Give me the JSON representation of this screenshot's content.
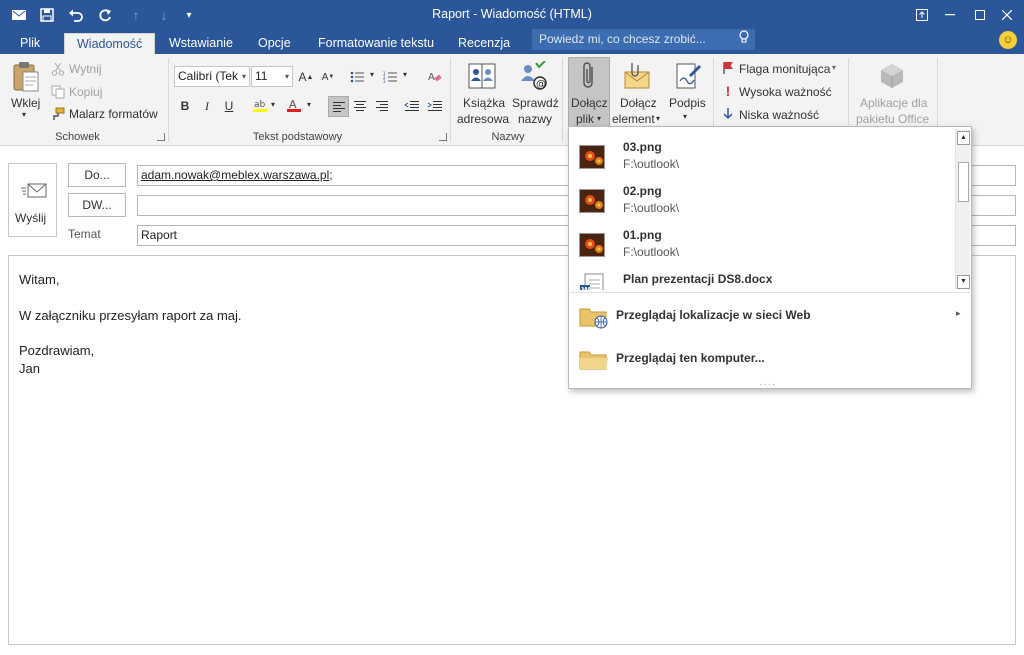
{
  "window": {
    "title": "Raport - Wiadomość (HTML)"
  },
  "tabs": [
    "Plik",
    "Wiadomość",
    "Wstawianie",
    "Opcje",
    "Formatowanie tekstu",
    "Recenzja"
  ],
  "tell_me": {
    "placeholder": "Powiedz mi, co chcesz zrobić..."
  },
  "ribbon": {
    "schowek": {
      "label": "Schowek",
      "paste": "Wklej",
      "cut": "Wytnij",
      "copy": "Kopiuj",
      "format_painter": "Malarz formatów"
    },
    "text": {
      "label": "Tekst podstawowy",
      "font": "Calibri (Tek",
      "size": "11",
      "bold": "B",
      "italic": "I",
      "underline": "U"
    },
    "names": {
      "label": "Nazwy",
      "address_book_1": "Książka",
      "address_book_2": "adresowa",
      "check_names_1": "Sprawdź",
      "check_names_2": "nazwy"
    },
    "include": {
      "attach_file_1": "Dołącz",
      "attach_file_2": "plik",
      "attach_item_1": "Dołącz",
      "attach_item_2": "element",
      "signature": "Podpis"
    },
    "tags": {
      "follow_up": "Flaga monitująca",
      "high_importance": "Wysoka ważność",
      "low_importance": "Niska ważność"
    },
    "addins": {
      "apps_1": "Aplikacje dla",
      "apps_2": "pakietu Office"
    }
  },
  "compose": {
    "send": "Wyślij",
    "to_button": "Do...",
    "cc_button": "DW...",
    "subject_label": "Temat",
    "to_value": "adam.nowak@meblex.warszawa.pl;",
    "cc_value": "",
    "subject_value": "Raport"
  },
  "body": {
    "line1": "Witam,",
    "line2": "W załączniku przesyłam raport za maj.",
    "line3": "Pozdrawiam,",
    "line4": "Jan"
  },
  "recent_files": [
    {
      "name": "03.png",
      "path": "F:\\outlook\\"
    },
    {
      "name": "02.png",
      "path": "F:\\outlook\\"
    },
    {
      "name": "01.png",
      "path": "F:\\outlook\\"
    },
    {
      "name": "Plan prezentacji DS8.docx",
      "path": ""
    }
  ],
  "dropdown_actions": {
    "browse_web": "Przeglądaj lokalizacje w sieci Web",
    "browse_pc": "Przeglądaj ten komputer..."
  },
  "colors": {
    "accent": "#2b579a",
    "ribbon_bg": "#f3f3f3",
    "flag_red": "#d13438",
    "font_color_red": "#e02020",
    "highlight_yellow": "#ffff00"
  }
}
